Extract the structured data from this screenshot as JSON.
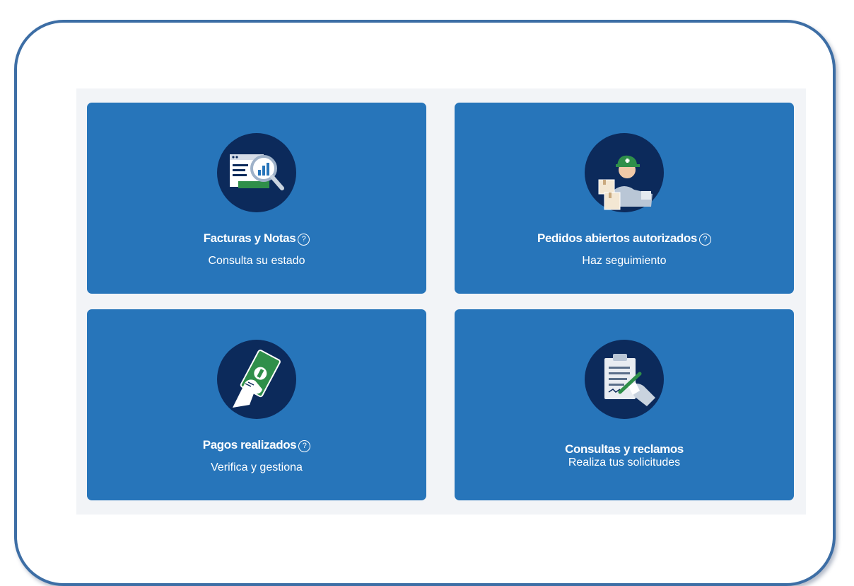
{
  "cards": [
    {
      "title": "Facturas y Notas",
      "subtitle": "Consulta su estado",
      "icon": "invoice-magnifier-icon",
      "has_help": true
    },
    {
      "title": "Pedidos abiertos autorizados",
      "subtitle": "Haz seguimiento",
      "icon": "delivery-person-icon",
      "has_help": true
    },
    {
      "title": "Pagos realizados",
      "subtitle": "Verifica y gestiona",
      "icon": "hand-money-icon",
      "has_help": true
    },
    {
      "title": "Consultas y reclamos",
      "subtitle": "Realiza tus solicitudes",
      "icon": "clipboard-pen-icon",
      "has_help": false
    }
  ],
  "help_glyph": "?",
  "colors": {
    "card": "#2775ba",
    "icon_circle": "#0c2a5b",
    "frame": "#3d6ea5",
    "panel": "#f2f4f7"
  }
}
